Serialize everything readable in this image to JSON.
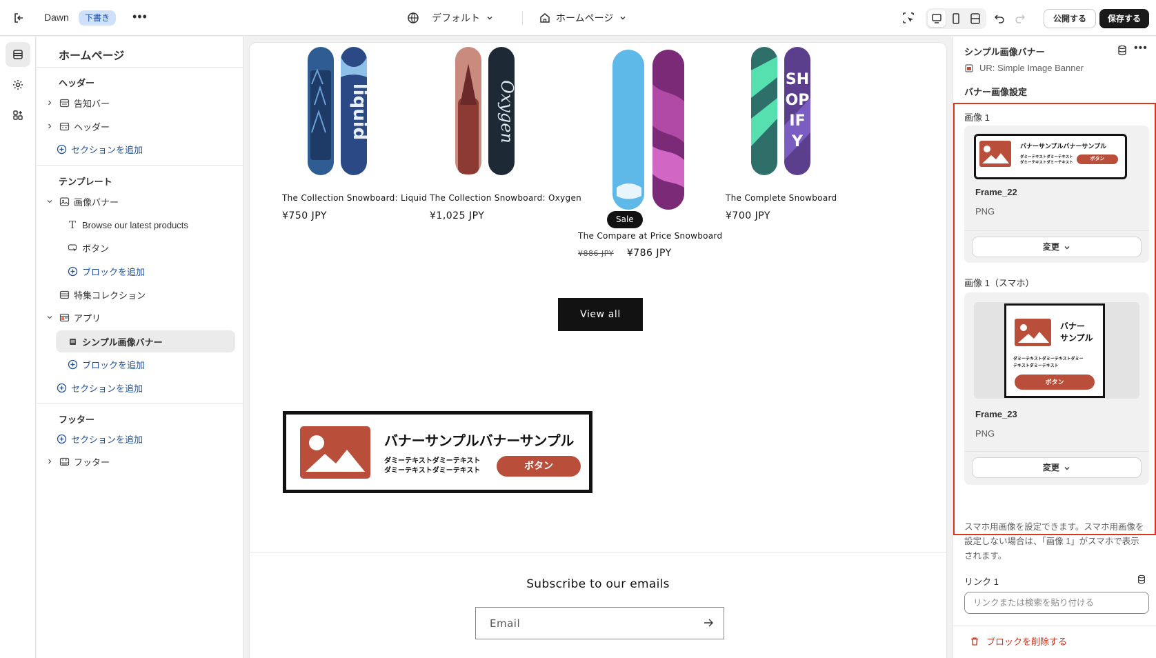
{
  "topbar": {
    "theme_name": "Dawn",
    "draft_badge": "下書き",
    "more": "•••",
    "template_select": "デフォルト",
    "page_select": "ホームページ",
    "publish": "公開する",
    "save": "保存する"
  },
  "left": {
    "title": "ホームページ",
    "header_group": "ヘッダー",
    "header_items": [
      "告知バー",
      "ヘッダー"
    ],
    "add_section": "セクションを追加",
    "template_group": "テンプレート",
    "image_banner": "画像バナー",
    "image_banner_blocks": [
      "Browse our latest products",
      "ボタン"
    ],
    "add_block": "ブロックを追加",
    "featured_collection": "特集コレクション",
    "apps": "アプリ",
    "app_block": "シンプル画像バナー",
    "footer_group": "フッター",
    "footer_item": "フッター"
  },
  "preview": {
    "products": [
      {
        "name": "The Collection Snowboard: Liquid",
        "price": "¥750 JPY"
      },
      {
        "name": "The Collection Snowboard: Oxygen",
        "price": "¥1,025 JPY"
      },
      {
        "name": "The Compare at Price Snowboard",
        "compare_price": "¥886 JPY",
        "price": "¥786 JPY",
        "badge": "Sale"
      },
      {
        "name": "The Complete Snowboard",
        "price": "¥700 JPY"
      }
    ],
    "view_all": "View all",
    "banner": {
      "title": "バナーサンプルバナーサンプル",
      "text_line1": "ダミーテキストダミーテキスト",
      "text_line2": "ダミーテキストダミーテキスト",
      "button": "ボタン"
    },
    "subscribe_title": "Subscribe to our emails",
    "email_placeholder": "Email"
  },
  "right": {
    "title": "シンプル画像バナー",
    "subtitle": "UR: Simple Image Banner",
    "section_heading": "バナー画像設定",
    "image1_label": "画像 1",
    "image1": {
      "file": "Frame_22",
      "type": "PNG",
      "thumb_title": "バナーサンプルバナーサンプル",
      "thumb_text": "ダミーテキストダミーテキスト",
      "thumb_button": "ボタン"
    },
    "change": "変更",
    "image1_mobile_label": "画像 1（スマホ）",
    "image1_mobile": {
      "file": "Frame_23",
      "type": "PNG",
      "thumb_title1": "バナー",
      "thumb_title2": "サンプル",
      "thumb_text1": "ダミーテキストダミーテキストダミー",
      "thumb_text2": "テキストダミーテキスト",
      "thumb_button": "ボタン"
    },
    "help_text": "スマホ用画像を設定できます。スマホ用画像を設定しない場合は、「画像 1」がスマホで表示されます。",
    "link_label": "リンク 1",
    "link_placeholder": "リンクまたは検索を貼り付ける",
    "delete_block": "ブロックを削除する"
  },
  "colors": {
    "accent_red": "#e0321c",
    "banner_brand": "#b94f3a",
    "link_blue": "#1f5199"
  }
}
